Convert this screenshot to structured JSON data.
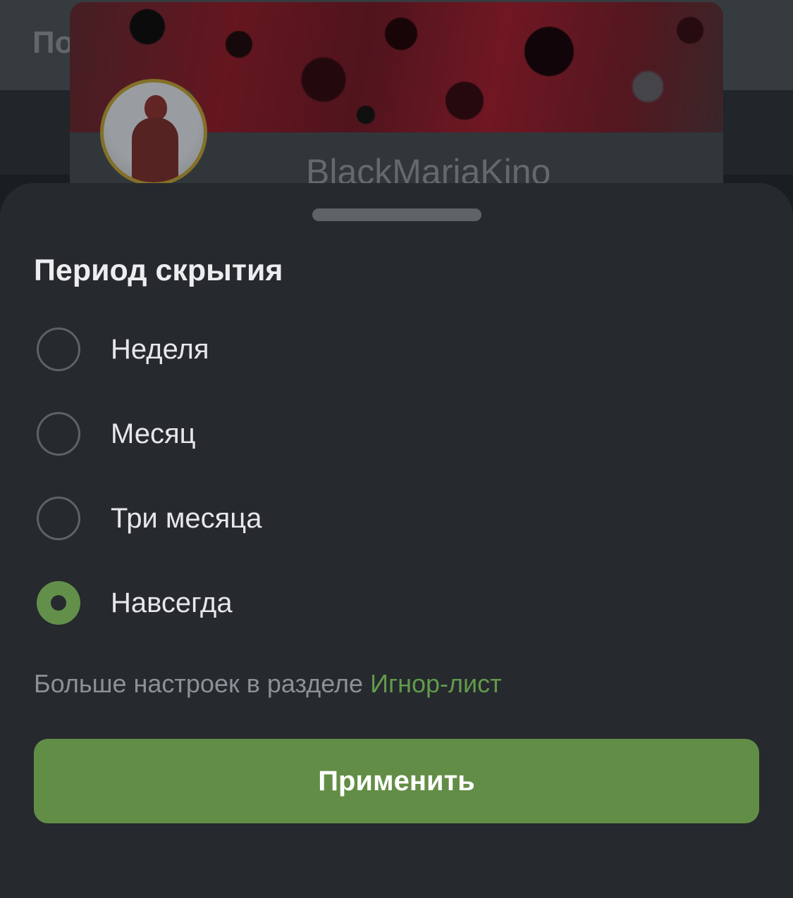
{
  "background": {
    "header_title": "По",
    "username": "BlackMariaKino"
  },
  "sheet": {
    "title": "Период скрытия",
    "options": [
      {
        "label": "Неделя",
        "selected": false
      },
      {
        "label": "Месяц",
        "selected": false
      },
      {
        "label": "Три месяца",
        "selected": false
      },
      {
        "label": "Навсегда",
        "selected": true
      }
    ],
    "hint_text": "Больше настроек в разделе ",
    "hint_link": "Игнор-лист",
    "apply_label": "Применить"
  },
  "colors": {
    "accent": "#628d46",
    "sheet_bg": "#26292e"
  }
}
